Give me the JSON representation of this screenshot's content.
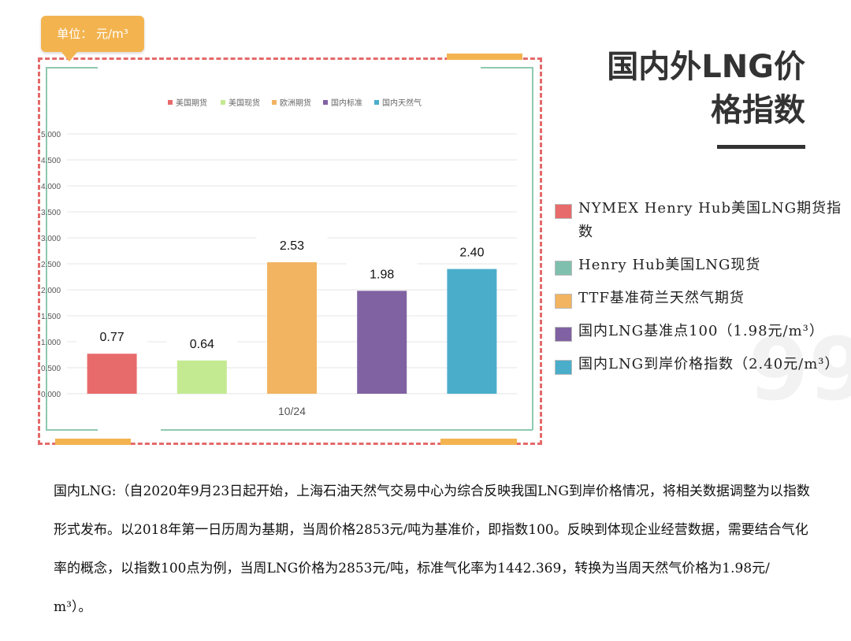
{
  "unit_label": "单位： 元/m³",
  "title_line1": "国内外LNG价",
  "title_line2": "格指数",
  "chart_data": {
    "type": "bar",
    "categories": [
      "10/24"
    ],
    "series": [
      {
        "name": "美国期货",
        "value": 0.77,
        "label": "0.77",
        "color": "#e86b6b"
      },
      {
        "name": "美国现货",
        "value": 0.64,
        "label": "0.64",
        "color": "#c4ea91"
      },
      {
        "name": "欧洲期货",
        "value": 2.53,
        "label": "2.53",
        "color": "#f2b461"
      },
      {
        "name": "国内标准",
        "value": 1.98,
        "label": "1.98",
        "color": "#8062a2"
      },
      {
        "name": "国内天然气",
        "value": 2.4,
        "label": "2.40",
        "color": "#4aaecb"
      }
    ],
    "yticks": [
      "0.000",
      "0.500",
      "1.000",
      "1.500",
      "2.000",
      "2.500",
      "3.000",
      "3.500",
      "4.000",
      "4.500",
      "5.000"
    ],
    "ylim": [
      0,
      5
    ],
    "grid": true,
    "legend_position": "top"
  },
  "side_legend": [
    {
      "text": "NYMEX Henry Hub美国LNG期货指数",
      "color": "#e86b6b"
    },
    {
      "text": "Henry Hub美国LNG现货",
      "color": "#7fbfae"
    },
    {
      "text": "TTF基准荷兰天然气期货",
      "color": "#f2b461"
    },
    {
      "text": "国内LNG基准点100（1.98元/m³）",
      "color": "#8062a2"
    },
    {
      "text": "国内LNG到岸价格指数（2.40元/m³）",
      "color": "#4aaecb"
    }
  ],
  "body_paragraph": "国内LNG:（自2020年9月23日起开始，上海石油天然气交易中心为综合反映我国LNG到岸价格情况，将相关数据调整为以指数形式发布。以2018年第一日历周为基期，当周价格2853元/吨为基准价，即指数100。反映到体现企业经营数据，需要结合气化率的概念，以指数100点为例，当周LNG价格为2853元/吨，标准气化率为1442.369，转换为当周天然气价格为1.98元/ m³）。",
  "watermark": "99"
}
